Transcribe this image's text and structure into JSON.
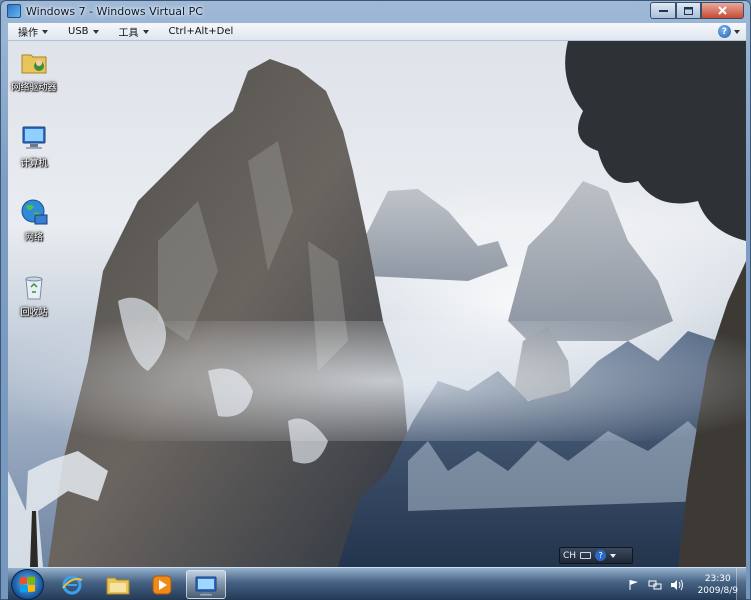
{
  "window": {
    "title": "Windows 7 - Windows Virtual PC"
  },
  "menu": {
    "items": [
      {
        "label": "操作"
      },
      {
        "label": "USB"
      },
      {
        "label": "工具"
      },
      {
        "label": "Ctrl+Alt+Del"
      }
    ]
  },
  "desktop": {
    "icons": [
      {
        "label": "网络驱动器",
        "icon": "user-folder-icon"
      },
      {
        "label": "计算机",
        "icon": "computer-icon"
      },
      {
        "label": "网络",
        "icon": "network-globe-icon"
      },
      {
        "label": "回收站",
        "icon": "recycle-bin-icon"
      }
    ]
  },
  "language_bar": {
    "lang": "CH"
  },
  "taskbar": {
    "pinned": [
      {
        "icon": "internet-explorer-icon"
      },
      {
        "icon": "explorer-folder-icon"
      },
      {
        "icon": "media-player-icon"
      },
      {
        "icon": "remote-desktop-icon"
      }
    ]
  },
  "clock": {
    "time": "23:30",
    "date": "2009/8/9"
  },
  "colors": {
    "accent": "#2a69c7",
    "close": "#c74a33"
  }
}
